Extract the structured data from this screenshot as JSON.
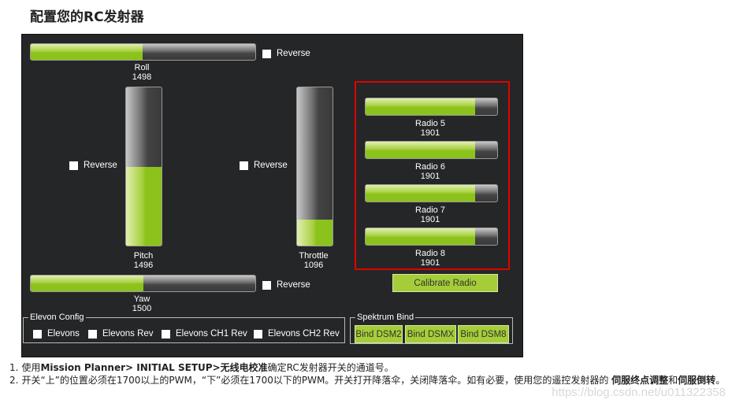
{
  "title": "配置您的RC发射器",
  "reverse_label": "Reverse",
  "channels": {
    "roll": {
      "label": "Roll",
      "value": 1498
    },
    "pitch": {
      "label": "Pitch",
      "value": 1496
    },
    "throttle": {
      "label": "Throttle",
      "value": 1096
    },
    "yaw": {
      "label": "Yaw",
      "value": 1500
    }
  },
  "radios": [
    {
      "label": "Radio 5",
      "value": 1901
    },
    {
      "label": "Radio 6",
      "value": 1901
    },
    {
      "label": "Radio 7",
      "value": 1901
    },
    {
      "label": "Radio 8",
      "value": 1901
    }
  ],
  "calibrate_label": "Calibrate Radio",
  "elevon": {
    "legend": "Elevon Config",
    "options": [
      "Elevons",
      "Elevons Rev",
      "Elevons CH1 Rev",
      "Elevons CH2 Rev"
    ]
  },
  "spektrum": {
    "legend": "Spektrum Bind",
    "buttons": [
      "Bind DSM2",
      "Bind DSMX",
      "Bind DSM8"
    ]
  },
  "colors": {
    "bar_fill": "#8cc21c",
    "highlight_box": "#e00000",
    "panel_bg": "#252627"
  },
  "notes": [
    {
      "num": "1.",
      "parts": [
        {
          "t": "使用",
          "b": false
        },
        {
          "t": "Mission Planner> INITIAL SETUP>无线电校准",
          "b": true
        },
        {
          "t": "确定RC发射器开关的通道号。",
          "b": false
        }
      ]
    },
    {
      "num": "2.",
      "parts": [
        {
          "t": "开关“上”的位置必须在1700以上的PWM，“下”必须在1700以下的PWM。开关打开降落伞，关闭降落伞。如有必要，使用您的遥控发射器的 ",
          "b": false
        },
        {
          "t": "伺服终点调整",
          "b": true
        },
        {
          "t": "和",
          "b": false
        },
        {
          "t": "伺服倒转",
          "b": true
        },
        {
          "t": "。",
          "b": false
        }
      ]
    }
  ],
  "watermark": "https://blog.csdn.net/u011322358"
}
